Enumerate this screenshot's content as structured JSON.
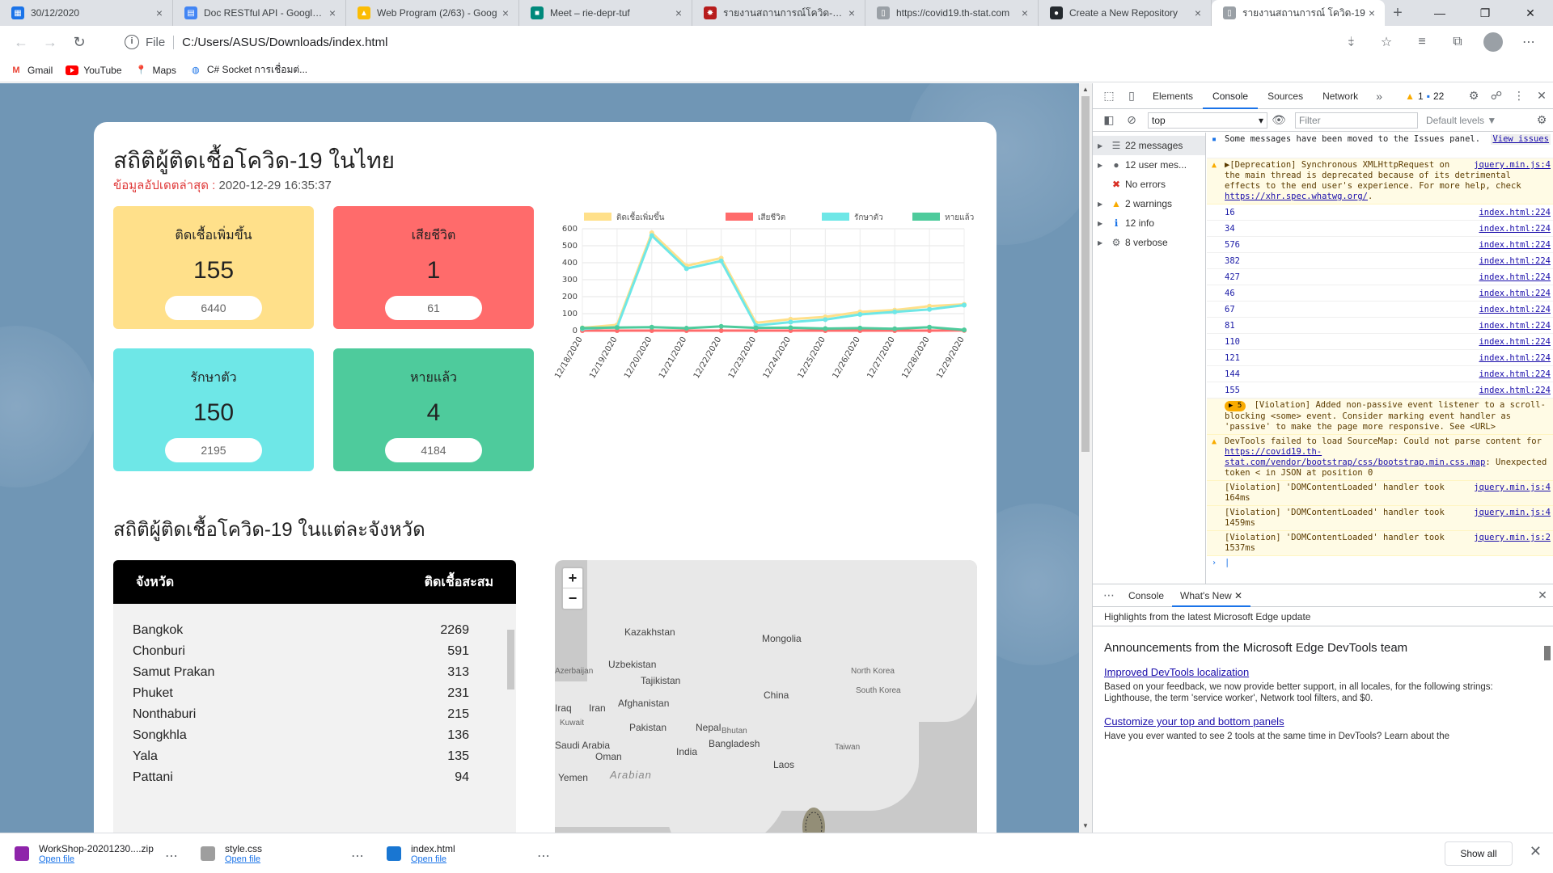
{
  "browser": {
    "tabs": [
      {
        "title": "30/12/2020",
        "icon": "calendar-icon",
        "color": "#1a73e8"
      },
      {
        "title": "Doc RESTful API - Google D",
        "icon": "docs-icon",
        "color": "#4285f4"
      },
      {
        "title": "Web Program (2/63) - Goog",
        "icon": "drive-icon",
        "color": "#fbbc04"
      },
      {
        "title": "Meet – rie-depr-tuf",
        "icon": "meet-icon",
        "color": "#00897b"
      },
      {
        "title": "รายงานสถานการณ์โควิด-19 ป",
        "icon": "virus-icon",
        "color": "#b71c1c"
      },
      {
        "title": "https://covid19.th-stat.com",
        "icon": "page-icon",
        "color": "#9aa0a6"
      },
      {
        "title": "Create a New Repository",
        "icon": "github-icon",
        "color": "#24292e"
      },
      {
        "title": "รายงานสถานการณ์ โควิด-19",
        "icon": "page-icon",
        "color": "#9aa0a6"
      }
    ],
    "address": {
      "scheme": "File",
      "url": "C:/Users/ASUS/Downloads/index.html"
    },
    "bookmarks": [
      {
        "label": "Gmail",
        "icon": "gmail-icon"
      },
      {
        "label": "YouTube",
        "icon": "youtube-icon"
      },
      {
        "label": "Maps",
        "icon": "maps-icon"
      },
      {
        "label": "C# Socket การเชื่อมต่...",
        "icon": "globe-icon"
      }
    ]
  },
  "page": {
    "title": "สถิติผู้ติดเชื้อโควิด-19 ในไทย",
    "updated_label": "ข้อมูลอัปเดตล่าสุด :",
    "updated_value": "2020-12-29 16:35:37",
    "stats": [
      {
        "title": "ติดเชื้อเพิ่มขึ้น",
        "value": "155",
        "total": "6440",
        "color": "#ffe08a"
      },
      {
        "title": "เสียชีวิต",
        "value": "1",
        "total": "61",
        "color": "#ff6b6b"
      },
      {
        "title": "รักษาตัว",
        "value": "150",
        "total": "2195",
        "color": "#6ee7e7"
      },
      {
        "title": "หายแล้ว",
        "value": "4",
        "total": "4184",
        "color": "#4ecb9c"
      }
    ],
    "province_heading": "สถิติผู้ติดเชื้อโควิด-19 ในแต่ละจังหวัด",
    "province_table": {
      "col_province": "จังหวัด",
      "col_cases": "ติดเชื้อสะสม",
      "rows": [
        {
          "name": "Bangkok",
          "cases": "2269"
        },
        {
          "name": "Chonburi",
          "cases": "591"
        },
        {
          "name": "Samut Prakan",
          "cases": "313"
        },
        {
          "name": "Phuket",
          "cases": "231"
        },
        {
          "name": "Nonthaburi",
          "cases": "215"
        },
        {
          "name": "Songkhla",
          "cases": "136"
        },
        {
          "name": "Yala",
          "cases": "135"
        },
        {
          "name": "Pattani",
          "cases": "94"
        }
      ]
    },
    "map": {
      "zoom_in": "+",
      "zoom_out": "−",
      "labels": [
        "Kazakhstan",
        "Mongolia",
        "Uzbekistan",
        "Tajikistan",
        "Azerbaijan",
        "North Korea",
        "South Korea",
        "Afghanistan",
        "China",
        "Iran",
        "Kuwait",
        "Pakistan",
        "Nepal",
        "Bhutan",
        "Bangladesh",
        "Taiwan",
        "Saudi Arabia",
        "India",
        "Oman",
        "Yemen",
        "Arabian",
        "Laos",
        "Iraq"
      ]
    }
  },
  "chart_data": {
    "type": "line",
    "categories": [
      "12/18/2020",
      "12/19/2020",
      "12/20/2020",
      "12/21/2020",
      "12/22/2020",
      "12/23/2020",
      "12/24/2020",
      "12/25/2020",
      "12/26/2020",
      "12/27/2020",
      "12/28/2020",
      "12/29/2020"
    ],
    "series": [
      {
        "name": "ติดเชื้อเพิ่มขึ้น",
        "color": "#ffe08a",
        "values": [
          16,
          34,
          576,
          382,
          427,
          46,
          67,
          81,
          110,
          121,
          144,
          155
        ]
      },
      {
        "name": "เสียชีวิต",
        "color": "#ff6b6b",
        "values": [
          0,
          0,
          0,
          0,
          0,
          0,
          0,
          0,
          0,
          0,
          0,
          1
        ]
      },
      {
        "name": "รักษาตัว",
        "color": "#6ee7e7",
        "values": [
          10,
          20,
          560,
          365,
          410,
          30,
          50,
          65,
          95,
          110,
          125,
          150
        ]
      },
      {
        "name": "หายแล้ว",
        "color": "#4ecb9c",
        "values": [
          15,
          18,
          20,
          14,
          25,
          16,
          17,
          12,
          15,
          11,
          20,
          4
        ]
      }
    ],
    "ylim": [
      0,
      600
    ],
    "yticks": [
      0,
      100,
      200,
      300,
      400,
      500,
      600
    ],
    "legend": "top",
    "grid": true
  },
  "devtools": {
    "tabs": [
      "Elements",
      "Console",
      "Sources",
      "Network"
    ],
    "active_tab": "Console",
    "warn_count": "1",
    "msg_count": "22",
    "context": "top",
    "filter_placeholder": "Filter",
    "levels": "Default levels ▼",
    "sidebar": [
      {
        "label": "22 messages",
        "icon": "list-icon"
      },
      {
        "label": "12 user mes...",
        "icon": "user-icon"
      },
      {
        "label": "No errors",
        "icon": "error-icon"
      },
      {
        "label": "2 warnings",
        "icon": "warning-icon"
      },
      {
        "label": "12 info",
        "icon": "info-icon"
      },
      {
        "label": "8 verbose",
        "icon": "bug-icon"
      }
    ],
    "issues_msg": "Some messages have been moved to the Issues panel.",
    "issues_link": "View issues",
    "deprecation": {
      "text": "▶[Deprecation] Synchronous XMLHttpRequest on the main thread is deprecated because of its detrimental effects to the end user's experience. For more help, check",
      "link": "https://xhr.spec.whatwg.org/",
      "src": "jquery.min.js:4"
    },
    "logs": [
      {
        "value": "16",
        "src": "index.html:224"
      },
      {
        "value": "34",
        "src": "index.html:224"
      },
      {
        "value": "576",
        "src": "index.html:224"
      },
      {
        "value": "382",
        "src": "index.html:224"
      },
      {
        "value": "427",
        "src": "index.html:224"
      },
      {
        "value": "46",
        "src": "index.html:224"
      },
      {
        "value": "67",
        "src": "index.html:224"
      },
      {
        "value": "81",
        "src": "index.html:224"
      },
      {
        "value": "110",
        "src": "index.html:224"
      },
      {
        "value": "121",
        "src": "index.html:224"
      },
      {
        "value": "144",
        "src": "index.html:224"
      },
      {
        "value": "155",
        "src": "index.html:224"
      }
    ],
    "violation_passive": {
      "badge": "5",
      "text": "[Violation] Added non-passive event listener to a scroll-blocking <some> event. Consider marking event handler as 'passive' to make the page more responsive. See <URL>"
    },
    "sourcemap": {
      "text1": "DevTools failed to load SourceMap: Could not parse content for",
      "link": "https://covid19.th-stat.com/vendor/bootstrap/css/bootstrap.min.css.map",
      "text2": ": Unexpected token < in JSON at position 0"
    },
    "violations": [
      {
        "text": "[Violation] 'DOMContentLoaded' handler took 164ms",
        "src": "jquery.min.js:4"
      },
      {
        "text": "[Violation] 'DOMContentLoaded' handler took 1459ms",
        "src": "jquery.min.js:4"
      },
      {
        "text": "[Violation] 'DOMContentLoaded' handler took 1537ms",
        "src": "jquery.min.js:2"
      }
    ],
    "drawer": {
      "tabs": [
        "Console",
        "What's New"
      ],
      "subtitle": "Highlights from the latest Microsoft Edge update",
      "heading": "Announcements from the Microsoft Edge DevTools team",
      "link1": "Improved DevTools localization",
      "text1": "Based on your feedback, we now provide better support, in all locales, for the following strings: Lighthouse, the term 'service worker', Network tool filters, and $0.",
      "link2": "Customize your top and bottom panels",
      "text2": "Have you ever wanted to see 2 tools at the same time in DevTools? Learn about the"
    }
  },
  "downloads": {
    "items": [
      {
        "name": "WorkShop-20201230....zip",
        "open": "Open file",
        "color": "#8e24aa"
      },
      {
        "name": "style.css",
        "open": "Open file",
        "color": "#9e9e9e"
      },
      {
        "name": "index.html",
        "open": "Open file",
        "color": "#1976d2"
      }
    ],
    "show_all": "Show all"
  }
}
